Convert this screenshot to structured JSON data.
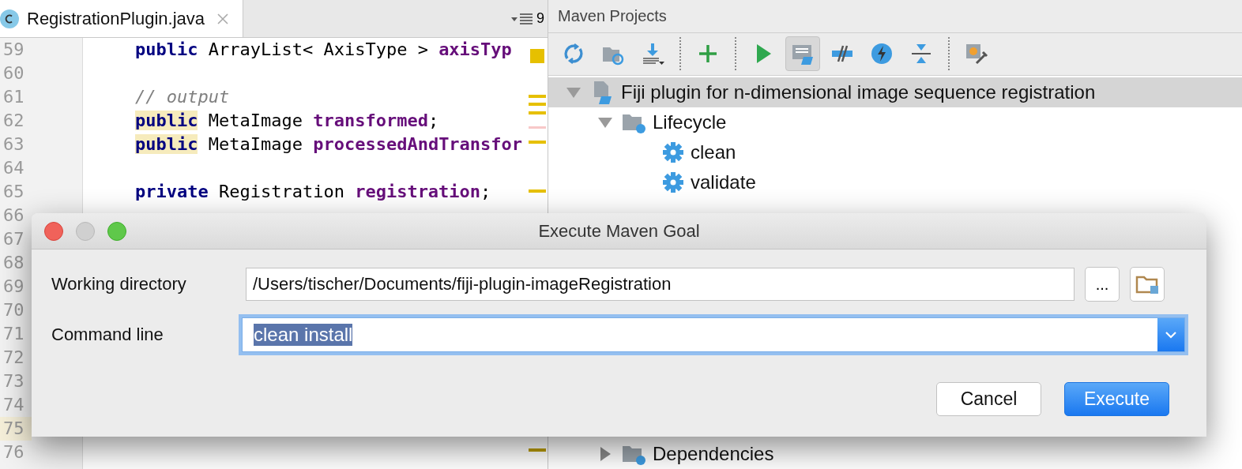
{
  "editor": {
    "tab": {
      "title": "RegistrationPlugin.java",
      "selected": true
    },
    "tab_count": "9",
    "lines": [
      {
        "number": "59",
        "current": false,
        "tokens": [
          {
            "text": "public",
            "kind": "keyword",
            "highlighted": false
          },
          {
            "text": " ArrayList< AxisType > ",
            "kind": "plain",
            "highlighted": false
          },
          {
            "text": "axisTyp",
            "kind": "field",
            "highlighted": false
          }
        ]
      },
      {
        "number": "60",
        "current": false
      },
      {
        "number": "61",
        "current": false,
        "tokens": [
          {
            "text": "// output",
            "kind": "comment",
            "highlighted": false
          }
        ]
      },
      {
        "number": "62",
        "current": false,
        "tokens": [
          {
            "text": "public",
            "kind": "keyword",
            "highlighted": true
          },
          {
            "text": " MetaImage ",
            "kind": "plain",
            "highlighted": false
          },
          {
            "text": "transformed",
            "kind": "field",
            "highlighted": false
          },
          {
            "text": ";",
            "kind": "plain",
            "highlighted": false
          }
        ]
      },
      {
        "number": "63",
        "current": false,
        "tokens": [
          {
            "text": "public",
            "kind": "keyword",
            "highlighted": true
          },
          {
            "text": " MetaImage ",
            "kind": "plain",
            "highlighted": false
          },
          {
            "text": "processedAndTransfor",
            "kind": "field",
            "highlighted": false
          }
        ]
      },
      {
        "number": "64",
        "current": false
      },
      {
        "number": "65",
        "current": false,
        "tokens": [
          {
            "text": "private",
            "kind": "keyword",
            "highlighted": false
          },
          {
            "text": " Registration ",
            "kind": "plain",
            "highlighted": false
          },
          {
            "text": "registration",
            "kind": "field",
            "highlighted": false
          },
          {
            "text": ";",
            "kind": "plain",
            "highlighted": false
          }
        ]
      },
      {
        "number": "66",
        "current": false
      },
      {
        "number": "67",
        "current": false
      },
      {
        "number": "68",
        "current": false
      },
      {
        "number": "69",
        "current": false
      },
      {
        "number": "70",
        "current": false
      },
      {
        "number": "71",
        "current": false
      },
      {
        "number": "72",
        "current": false
      },
      {
        "number": "73",
        "current": false
      },
      {
        "number": "74",
        "current": false
      },
      {
        "number": "75",
        "current": true
      },
      {
        "number": "76",
        "current": false
      }
    ]
  },
  "maven": {
    "title": "Maven Projects",
    "tools": [
      {
        "kind": "refresh",
        "pressed": false
      },
      {
        "kind": "reimport",
        "pressed": false
      },
      {
        "kind": "download",
        "pressed": false
      },
      {
        "kind": "separator"
      },
      {
        "kind": "add",
        "pressed": false
      },
      {
        "kind": "separator"
      },
      {
        "kind": "run",
        "pressed": false
      },
      {
        "kind": "maven-goal",
        "pressed": true
      },
      {
        "kind": "skip-tests",
        "pressed": false
      },
      {
        "kind": "lightning",
        "pressed": false
      },
      {
        "kind": "collapse",
        "pressed": false
      },
      {
        "kind": "separator"
      },
      {
        "kind": "settings",
        "pressed": false
      }
    ],
    "tree": [
      {
        "label": "Fiji plugin for n-dimensional image sequence registration",
        "kind": "project",
        "selected": true,
        "expanded": true,
        "children": [
          {
            "label": "Lifecycle",
            "kind": "folder",
            "selected": false,
            "expanded": true,
            "children": [
              {
                "label": "clean",
                "kind": "goal",
                "selected": false
              },
              {
                "label": "validate",
                "kind": "goal",
                "selected": false
              }
            ]
          },
          {
            "label": "Dependencies",
            "kind": "folder",
            "selected": false,
            "expanded": false
          }
        ]
      }
    ]
  },
  "dialog": {
    "title": "Execute Maven Goal",
    "working_directory": {
      "label": "Working directory",
      "value": "/Users/tischer/Documents/fiji-plugin-imageRegistration",
      "browse": "..."
    },
    "command_line": {
      "label": "Command line",
      "value": "clean install",
      "selected": true,
      "focused": true
    },
    "buttons": [
      {
        "label": "Cancel",
        "default": false
      },
      {
        "label": "Execute",
        "default": true
      }
    ]
  }
}
